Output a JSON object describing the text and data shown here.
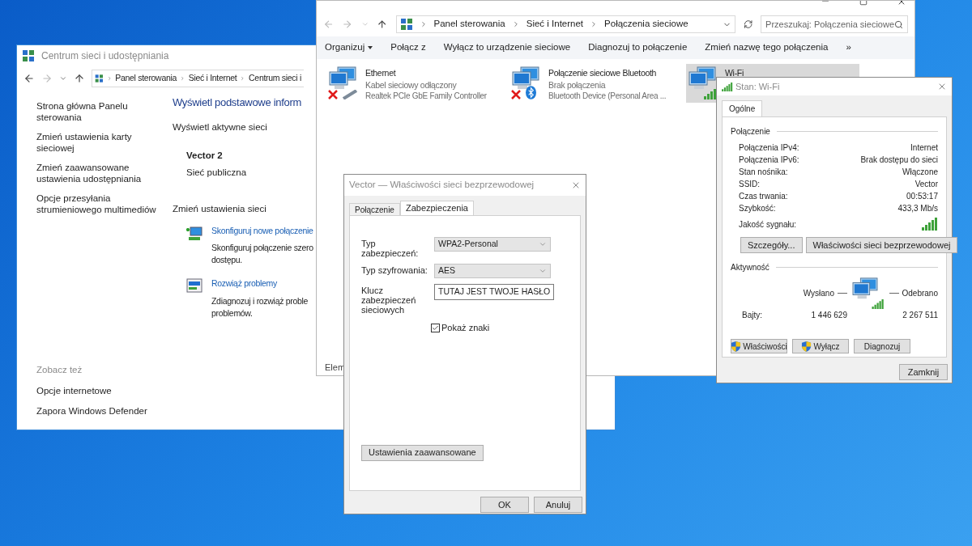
{
  "network_center": {
    "title": "Centrum sieci i udostępniania",
    "breadcrumb": [
      "Panel sterowania",
      "Sieć i Internet",
      "Centrum sieci i"
    ],
    "sidebar_links": [
      "Strona główna Panelu sterowania",
      "Zmień ustawienia karty sieciowej",
      "Zmień zaawansowane ustawienia udostępniania",
      "Opcje przesyłania strumieniowego multimediów"
    ],
    "see_also_heading": "Zobacz też",
    "see_also_links": [
      "Opcje internetowe",
      "Zapora Windows Defender"
    ],
    "heading": "Wyświetl podstawowe inform",
    "active_networks_label": "Wyświetl aktywne sieci",
    "network": {
      "name": "Vector 2",
      "type": "Sieć publiczna"
    },
    "change_settings_label": "Zmień ustawienia sieci",
    "tasks": [
      {
        "kind": "setup",
        "link": "Skonfiguruj nowe połączenie",
        "description": [
          "Skonfiguruj połączenie szero",
          "dostępu."
        ]
      },
      {
        "kind": "troubleshoot",
        "link": "Rozwiąż problemy",
        "description": [
          "Zdiagnozuj i rozwiąż proble",
          "problemów."
        ]
      }
    ]
  },
  "network_connections": {
    "breadcrumb": [
      "Panel sterowania",
      "Sieć i Internet",
      "Połączenia sieciowe"
    ],
    "search_placeholder": "Przeszukaj: Połączenia sieciowe",
    "toolbar": [
      {
        "label": "Organizuj",
        "dropdown": true
      },
      {
        "label": "Połącz z",
        "dropdown": false
      },
      {
        "label": "Wyłącz to urządzenie sieciowe",
        "dropdown": false
      },
      {
        "label": "Diagnozuj to połączenie",
        "dropdown": false
      },
      {
        "label": "Zmień nazwę tego połączenia",
        "dropdown": false
      }
    ],
    "overflow": "»",
    "connections": [
      {
        "kind": "ethernet",
        "name": "Ethernet",
        "status": "Kabel sieciowy odłączony",
        "device": "Realtek PCIe GbE Family Controller",
        "disconnected": true,
        "selected": false
      },
      {
        "kind": "bluetooth",
        "name": "Połączenie sieciowe Bluetooth",
        "status": "Brak połączenia",
        "device": "Bluetooth Device (Personal Area ...",
        "disconnected": true,
        "selected": false
      },
      {
        "kind": "wifi",
        "name": "Wi-Fi",
        "disconnected": false,
        "selected": true
      }
    ],
    "status_text": "Elem"
  },
  "properties_dialog": {
    "title": "Vector — Właściwości sieci bezprzewodowej",
    "tabs": [
      {
        "label": "Połączenie",
        "selected": false
      },
      {
        "label": "Zabezpieczenia",
        "selected": true
      }
    ],
    "fields": [
      {
        "kind": "dropdown",
        "label": "Typ zabezpieczeń:",
        "value": "WPA2-Personal"
      },
      {
        "kind": "dropdown",
        "label": "Typ szyfrowania:",
        "value": "AES"
      },
      {
        "kind": "text",
        "label": "Klucz zabezpieczeń sieciowych",
        "value": "TUTAJ JEST TWOJE HASŁO"
      }
    ],
    "show_characters": {
      "label": "Pokaż znaki",
      "checked": true
    },
    "advanced_button": "Ustawienia zaawansowane",
    "buttons": [
      "OK",
      "Anuluj"
    ]
  },
  "status_dialog": {
    "title": "Stan: Wi-Fi",
    "tabs": [
      {
        "label": "Ogólne",
        "selected": true
      }
    ],
    "connection_label": "Połączenie",
    "rows": [
      {
        "label": "Połączenia IPv4:",
        "value": "Internet"
      },
      {
        "label": "Połączenia IPv6:",
        "value": "Brak dostępu do sieci"
      },
      {
        "label": "Stan nośnika:",
        "value": "Włączone"
      },
      {
        "label": "SSID:",
        "value": "Vector"
      },
      {
        "label": "Czas trwania:",
        "value": "00:53:17"
      },
      {
        "label": "Szybkość:",
        "value": "433,3 Mb/s"
      }
    ],
    "signal_label": "Jakość sygnału:",
    "connection_buttons": [
      "Szczegóły...",
      "Właściwości sieci bezprzewodowej"
    ],
    "activity_label": "Aktywność",
    "sent_label": "Wysłano",
    "received_label": "Odebrano",
    "bytes_label": "Bajty:",
    "bytes_sent": "1 446 629",
    "bytes_received": "2 267 511",
    "action_buttons": [
      {
        "label": "Właściwości",
        "shield": true
      },
      {
        "label": "Wyłącz",
        "shield": true
      },
      {
        "label": "Diagnozuj",
        "shield": false
      }
    ],
    "close_button": "Zamknij"
  }
}
